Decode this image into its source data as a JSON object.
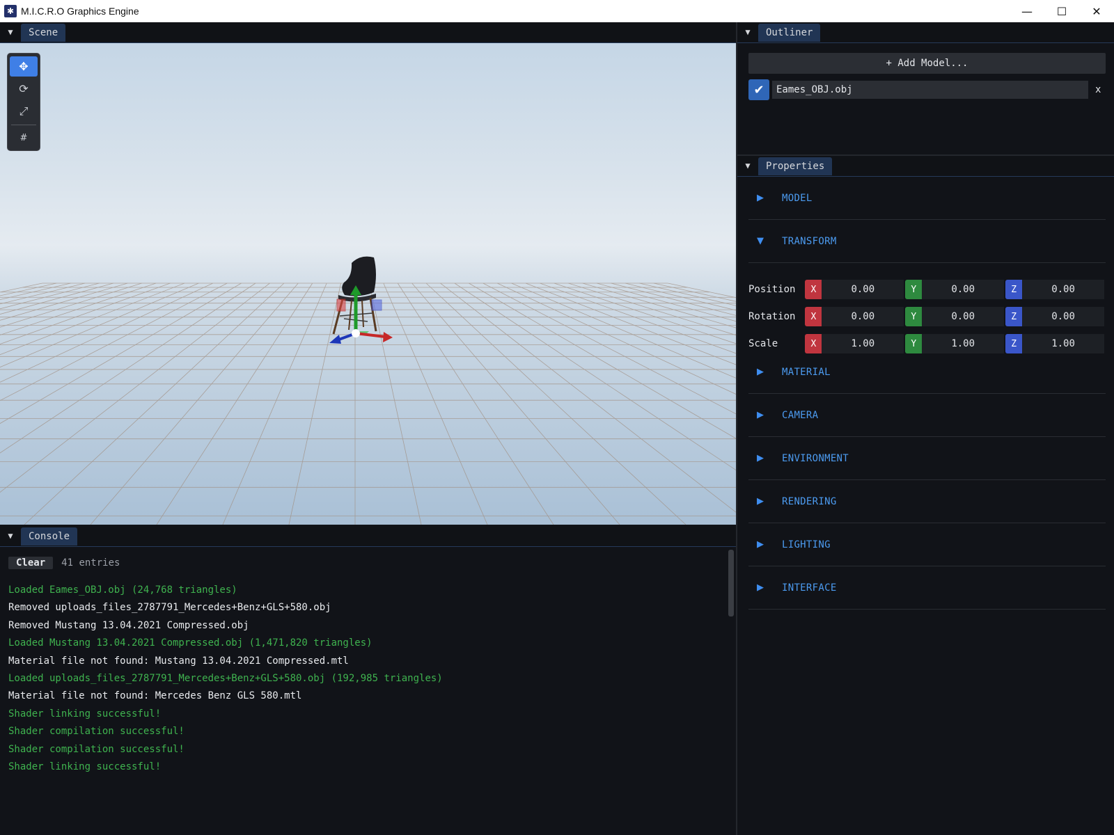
{
  "window": {
    "title": "M.I.C.R.O Graphics Engine",
    "minimize_glyph": "—",
    "maximize_glyph": "☐",
    "close_glyph": "✕"
  },
  "scene": {
    "tab_label": "Scene",
    "tools": [
      {
        "name": "move-tool",
        "glyph": "✥",
        "active": true
      },
      {
        "name": "rotate-tool",
        "glyph": "⟳",
        "active": false
      },
      {
        "name": "scale-tool",
        "glyph": "⤢",
        "active": false
      },
      {
        "name": "grid-toggle",
        "glyph": "#",
        "active": false
      }
    ]
  },
  "console": {
    "tab_label": "Console",
    "clear_label": "Clear",
    "entries_count": "41 entries",
    "lines": [
      {
        "text": "Loaded Eames_OBJ.obj (24,768 triangles)",
        "kind": "ok"
      },
      {
        "text": "Removed uploads_files_2787791_Mercedes+Benz+GLS+580.obj",
        "kind": "info"
      },
      {
        "text": "Removed Mustang 13.04.2021 Compressed.obj",
        "kind": "info"
      },
      {
        "text": "Loaded Mustang 13.04.2021 Compressed.obj (1,471,820 triangles)",
        "kind": "ok"
      },
      {
        "text": "Material file not found: Mustang 13.04.2021 Compressed.mtl",
        "kind": "info"
      },
      {
        "text": "Loaded uploads_files_2787791_Mercedes+Benz+GLS+580.obj (192,985 triangles)",
        "kind": "ok"
      },
      {
        "text": "Material file not found: Mercedes Benz GLS 580.mtl",
        "kind": "info"
      },
      {
        "text": "Shader linking successful!",
        "kind": "ok"
      },
      {
        "text": "Shader compilation successful!",
        "kind": "ok"
      },
      {
        "text": "Shader compilation successful!",
        "kind": "ok"
      },
      {
        "text": "Shader linking successful!",
        "kind": "ok"
      }
    ]
  },
  "outliner": {
    "tab_label": "Outliner",
    "add_model_label": "+ Add Model...",
    "models": [
      {
        "name": "Eames_OBJ.obj",
        "visible": true,
        "remove_label": "x"
      }
    ]
  },
  "properties": {
    "tab_label": "Properties",
    "sections": [
      {
        "label": "MODEL",
        "expanded": false
      },
      {
        "label": "TRANSFORM",
        "expanded": true
      },
      {
        "label": "MATERIAL",
        "expanded": false
      },
      {
        "label": "CAMERA",
        "expanded": false
      },
      {
        "label": "ENVIRONMENT",
        "expanded": false
      },
      {
        "label": "RENDERING",
        "expanded": false
      },
      {
        "label": "LIGHTING",
        "expanded": false
      },
      {
        "label": "INTERFACE",
        "expanded": false
      }
    ],
    "transform": [
      {
        "label": "Position",
        "x": "0.00",
        "y": "0.00",
        "z": "0.00"
      },
      {
        "label": "Rotation",
        "x": "0.00",
        "y": "0.00",
        "z": "0.00"
      },
      {
        "label": "Scale",
        "x": "1.00",
        "y": "1.00",
        "z": "1.00"
      }
    ],
    "axis_labels": {
      "x": "X",
      "y": "Y",
      "z": "Z"
    }
  },
  "colors": {
    "accent": "#3f7fe6",
    "axis_x": "#c0353f",
    "axis_y": "#2e8a3f",
    "axis_z": "#3a56c9",
    "log_ok": "#3fb34f",
    "section_label": "#4c9bf0"
  }
}
